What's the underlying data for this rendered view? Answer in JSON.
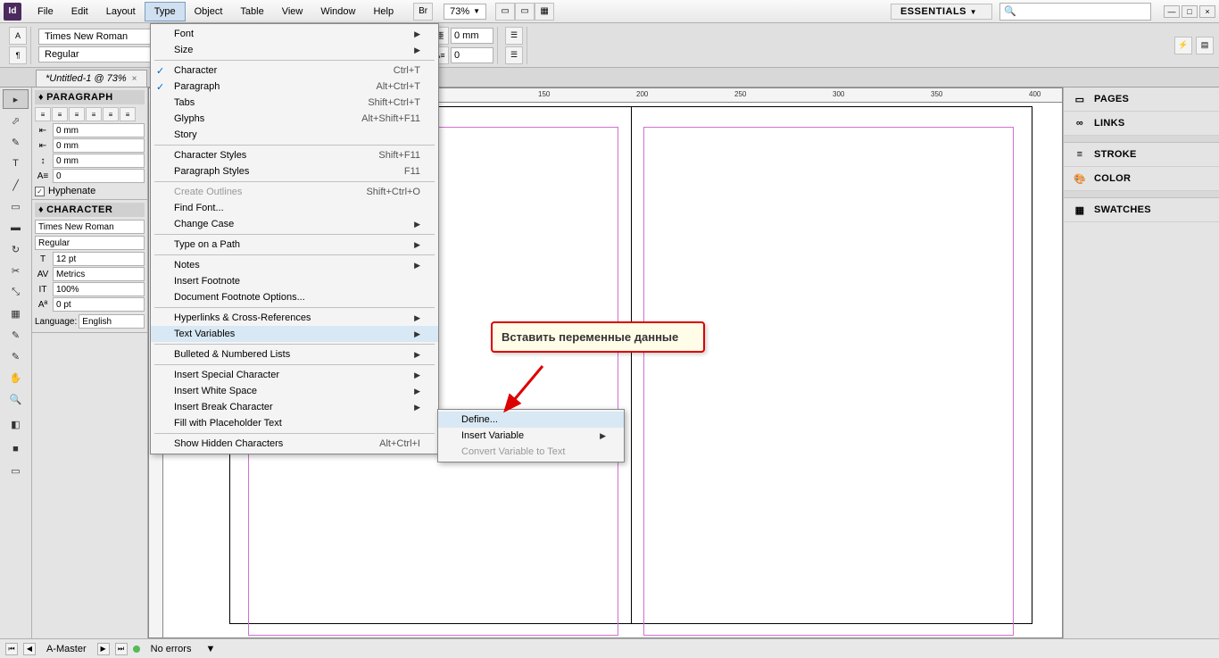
{
  "app_icon": "Id",
  "menus": [
    "File",
    "Edit",
    "Layout",
    "Type",
    "Object",
    "Table",
    "View",
    "Window",
    "Help"
  ],
  "active_menu_index": 3,
  "br_label": "Br",
  "zoom": "73%",
  "workspace": "ESSENTIALS",
  "search_placeholder": "🔍",
  "doc_tab": "*Untitled-1 @ 73%",
  "font_name": "Times New Roman",
  "font_style": "Regular",
  "ctrl_mm": "0 mm",
  "ctrl_zero": "0",
  "paragraph_panel": {
    "title": "PARAGRAPH",
    "indent": "0 mm",
    "zero": "0",
    "hyphenate": "Hyphenate"
  },
  "character_panel": {
    "title": "CHARACTER",
    "font": "Times New Roman",
    "style": "Regular",
    "size": "12 pt",
    "leading": "Metrics",
    "scale": "100%",
    "baseline": "0 pt",
    "lang_label": "Language:",
    "lang": "English"
  },
  "ruler_marks": [
    "150",
    "200",
    "250",
    "300",
    "350",
    "400"
  ],
  "right_panels": [
    "PAGES",
    "LINKS",
    "STROKE",
    "COLOR",
    "SWATCHES"
  ],
  "status": {
    "page": "A-Master",
    "errors": "No errors"
  },
  "type_menu": {
    "font": "Font",
    "size": "Size",
    "character": "Character",
    "paragraph": "Paragraph",
    "tabs": "Tabs",
    "glyphs": "Glyphs",
    "story": "Story",
    "char_styles": "Character Styles",
    "para_styles": "Paragraph Styles",
    "create_outlines": "Create Outlines",
    "find_font": "Find Font...",
    "change_case": "Change Case",
    "type_on_path": "Type on a Path",
    "notes": "Notes",
    "insert_footnote": "Insert Footnote",
    "doc_footnote": "Document Footnote Options...",
    "hyperlinks": "Hyperlinks & Cross-References",
    "text_vars": "Text Variables",
    "bulleted": "Bulleted & Numbered Lists",
    "insert_special": "Insert Special Character",
    "insert_white": "Insert White Space",
    "insert_break": "Insert Break Character",
    "fill_placeholder": "Fill with Placeholder Text",
    "show_hidden": "Show Hidden Characters",
    "sc_char": "Ctrl+T",
    "sc_para": "Alt+Ctrl+T",
    "sc_tabs": "Shift+Ctrl+T",
    "sc_glyphs": "Alt+Shift+F11",
    "sc_cstyle": "Shift+F11",
    "sc_pstyle": "F11",
    "sc_outlines": "Shift+Ctrl+O",
    "sc_hidden": "Alt+Ctrl+I"
  },
  "submenu": {
    "define": "Define...",
    "insert": "Insert Variable",
    "convert": "Convert Variable to Text"
  },
  "callout": "Вставить переменные данные"
}
